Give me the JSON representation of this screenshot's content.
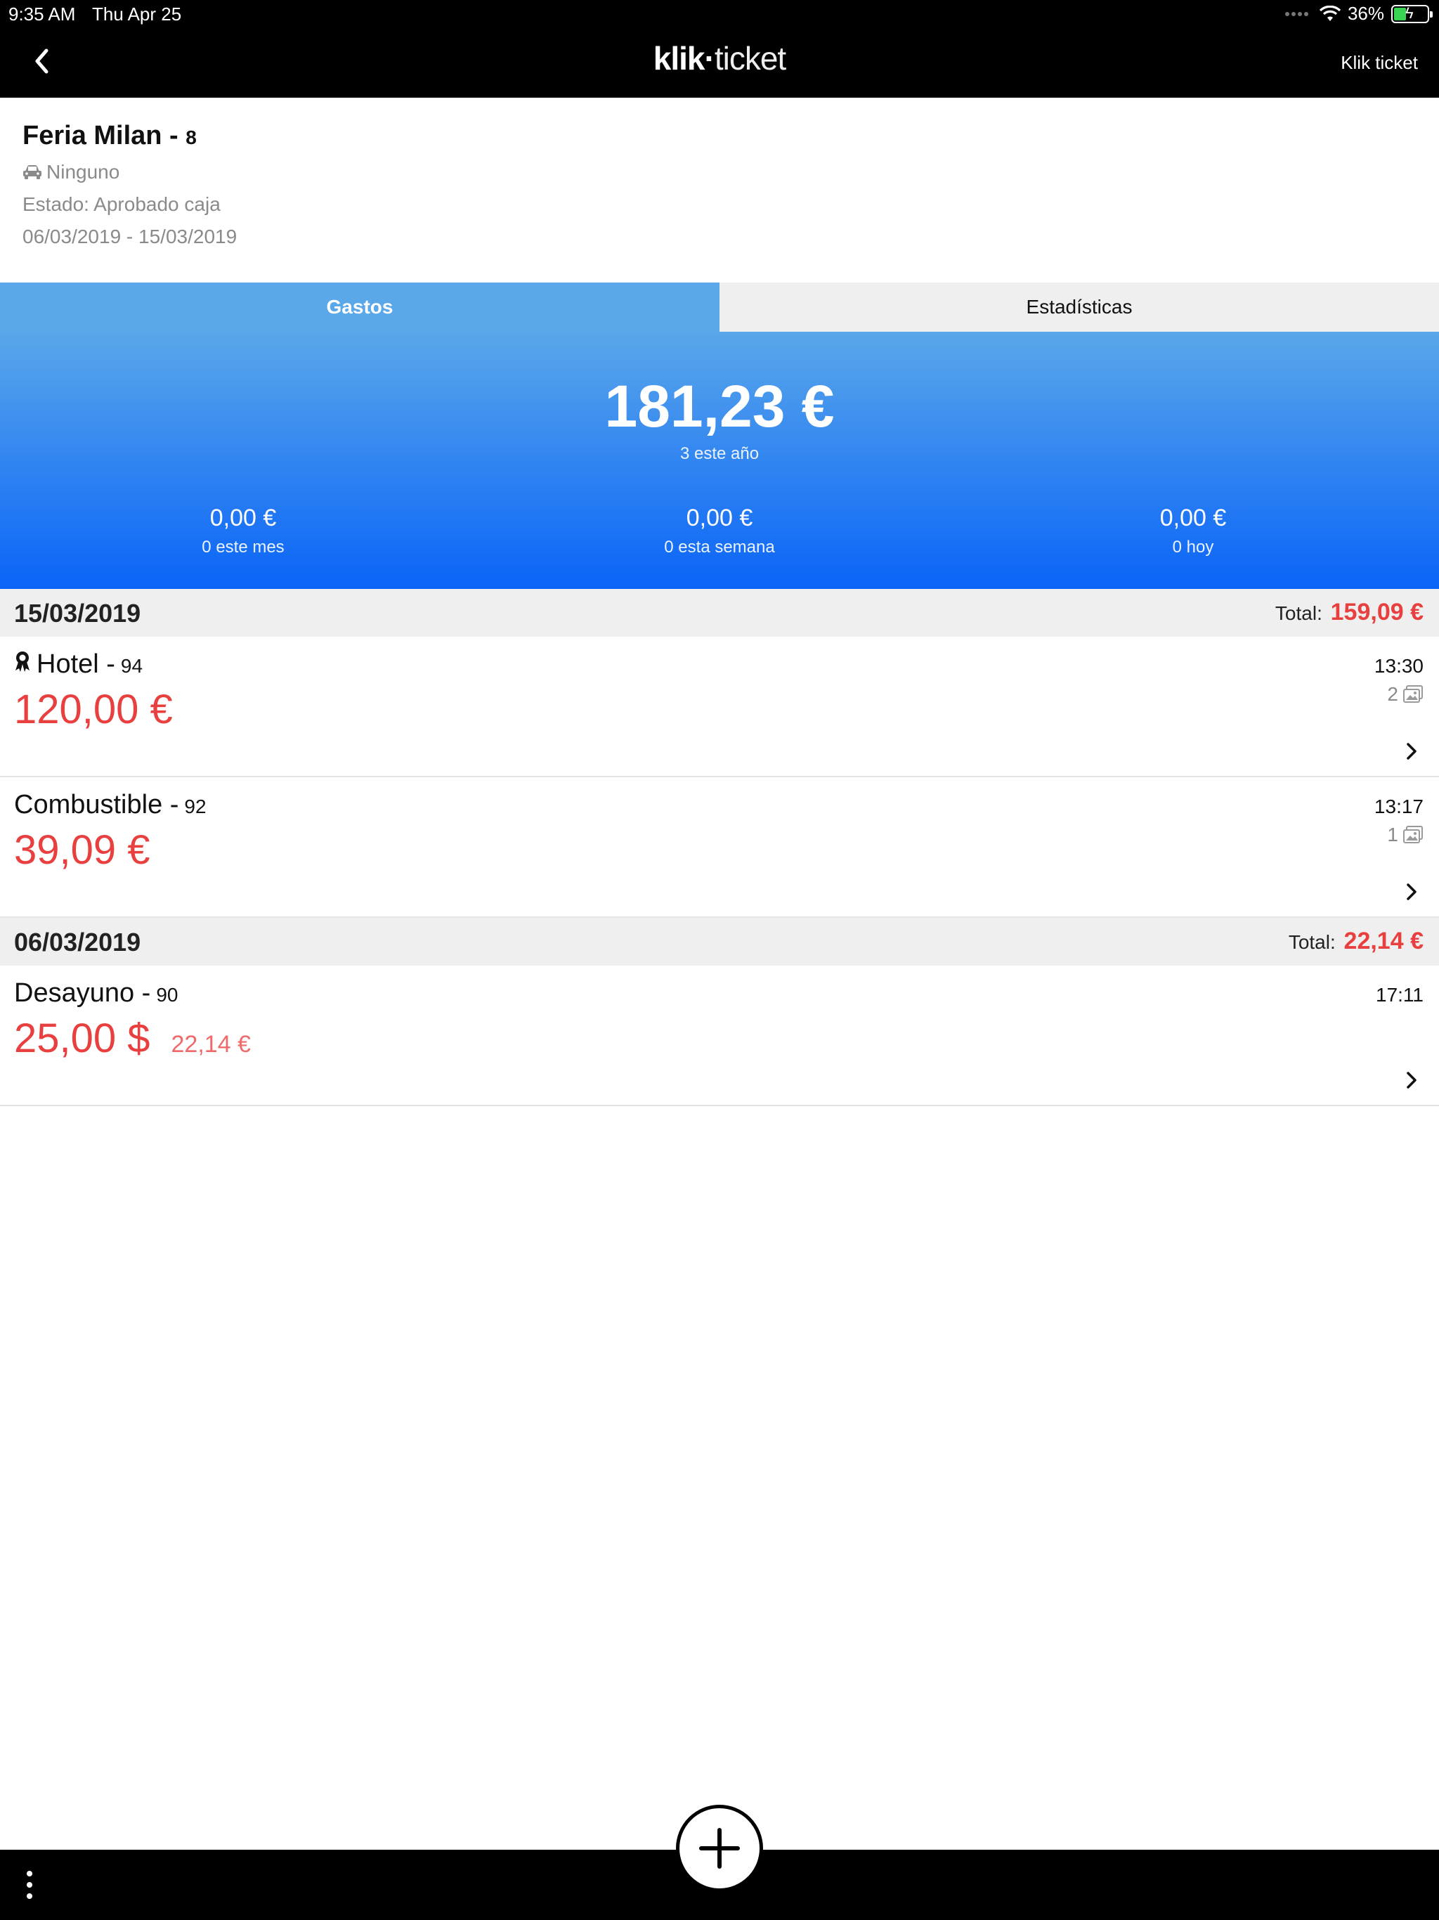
{
  "status_bar": {
    "time": "9:35 AM",
    "date": "Thu Apr 25",
    "battery": "36%",
    "battery_level": 0.36
  },
  "nav": {
    "logo_bold": "klik",
    "logo_dot": "·",
    "logo_light": "ticket",
    "right_label": "Klik ticket"
  },
  "trip": {
    "title": "Feria Milan - ",
    "number": "8",
    "vehicle": "Ninguno",
    "status": "Estado: Aprobado caja",
    "dates": "06/03/2019 - 15/03/2019"
  },
  "tabs": [
    {
      "label": "Gastos",
      "active": true
    },
    {
      "label": "Estadísticas",
      "active": false
    }
  ],
  "summary": {
    "total": "181,23 €",
    "total_sub": "3 este año",
    "month_value": "0,00 €",
    "month_label": "0 este mes",
    "week_value": "0,00 €",
    "week_label": "0 esta semana",
    "today_value": "0,00 €",
    "today_label": "0 hoy"
  },
  "sections": [
    {
      "date": "15/03/2019",
      "total_label": "Total:",
      "total": "159,09 €",
      "items": [
        {
          "name": "Hotel - ",
          "id": "94",
          "amount": "120,00 €",
          "time": "13:30",
          "attachments": "2",
          "icon": "award-icon"
        },
        {
          "name": "Combustible - ",
          "id": "92",
          "amount": "39,09 €",
          "time": "13:17",
          "attachments": "1"
        }
      ]
    },
    {
      "date": "06/03/2019",
      "total_label": "Total:",
      "total": "22,14 €",
      "items": [
        {
          "name": "Desayuno - ",
          "id": "90",
          "amount": "25,00 $",
          "converted": "22,14 €",
          "time": "17:11"
        }
      ]
    }
  ],
  "colors": {
    "accent_red": "#e8403f",
    "gradient_top": "#5aa7ea",
    "gradient_bottom": "#0a64f7"
  }
}
